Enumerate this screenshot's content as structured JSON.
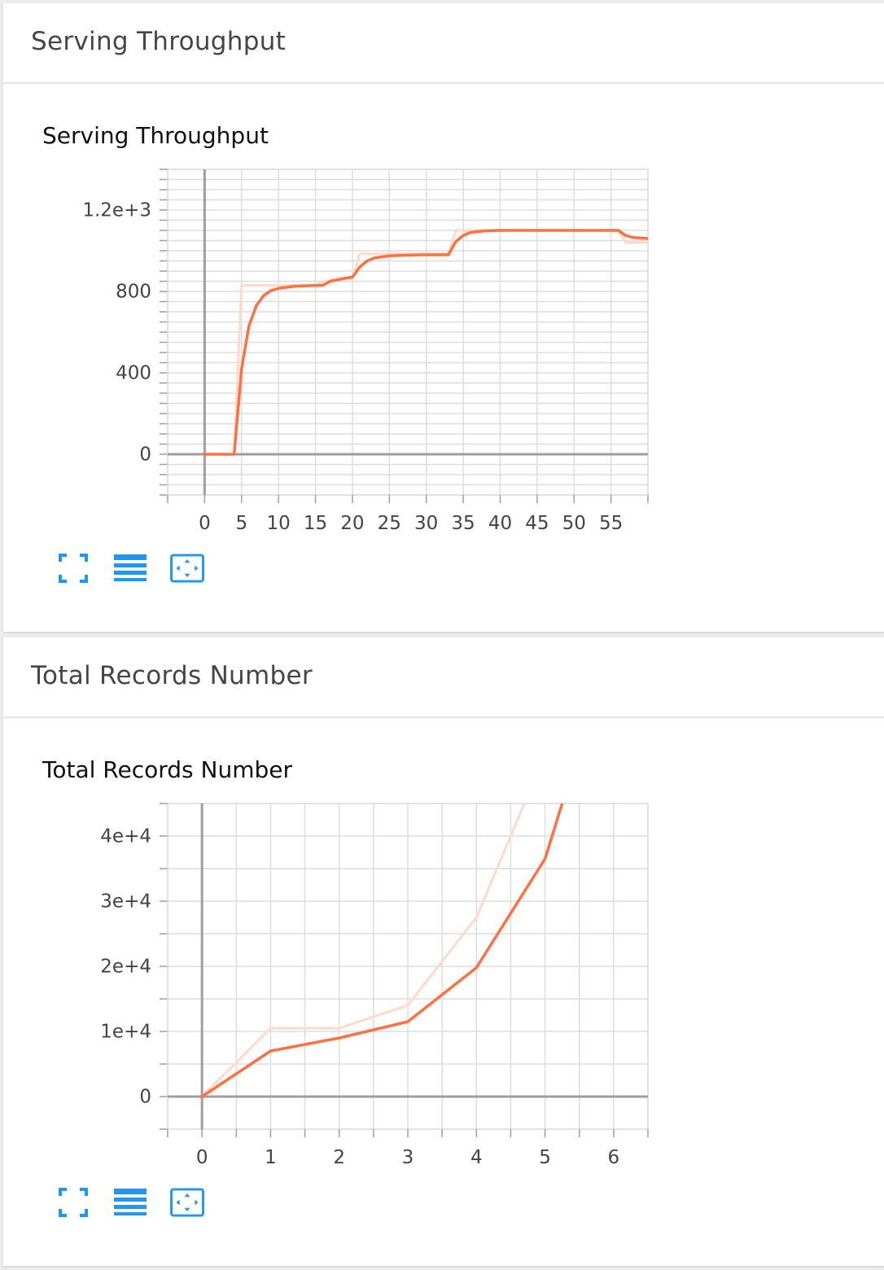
{
  "colors": {
    "smoothed": "#ff7043",
    "raw": "#ffd9cc",
    "grid": "#dddddd",
    "axis": "#9e9e9e",
    "tool": "#2196f3"
  },
  "toolbar": {
    "fit_icon": "fullscreen-icon",
    "log_icon": "lines-icon",
    "zoom_icon": "fit-domain-icon"
  },
  "cards": [
    {
      "header": "Serving Throughput",
      "chart_title": "Serving Throughput",
      "y_ticks": [
        "0",
        "400",
        "800",
        "1.2e+3"
      ],
      "x_ticks": [
        "0",
        "5",
        "10",
        "15",
        "20",
        "25",
        "30",
        "35",
        "40",
        "45",
        "50",
        "55"
      ]
    },
    {
      "header": "Total Records Number",
      "chart_title": "Total Records Number",
      "y_ticks": [
        "0",
        "1e+4",
        "2e+4",
        "3e+4",
        "4e+4"
      ],
      "x_ticks": [
        "0",
        "1",
        "2",
        "3",
        "4",
        "5",
        "6"
      ]
    }
  ],
  "chart_data": [
    {
      "type": "line",
      "title": "Serving Throughput",
      "xlabel": "",
      "ylabel": "",
      "xlim": [
        -5,
        60
      ],
      "ylim": [
        -200,
        1400
      ],
      "grid": true,
      "series": [
        {
          "role": "smoothed",
          "x": [
            0,
            4,
            5,
            6,
            7,
            8,
            9,
            10,
            12,
            14,
            16,
            17,
            19,
            20,
            21,
            22,
            23,
            25,
            27,
            30,
            33,
            34,
            35,
            36,
            38,
            40,
            45,
            50,
            56,
            57,
            58,
            60
          ],
          "y": [
            0,
            0,
            420,
            630,
            730,
            780,
            805,
            815,
            825,
            828,
            830,
            850,
            865,
            870,
            920,
            950,
            965,
            975,
            978,
            980,
            980,
            1045,
            1075,
            1090,
            1098,
            1100,
            1100,
            1100,
            1100,
            1075,
            1065,
            1060
          ]
        },
        {
          "role": "raw",
          "x": [
            0,
            4,
            5,
            10,
            15,
            16,
            20,
            21,
            33,
            34,
            56,
            57,
            60
          ],
          "y": [
            0,
            0,
            830,
            830,
            830,
            850,
            865,
            985,
            985,
            1100,
            1100,
            1040,
            1040
          ]
        }
      ]
    },
    {
      "type": "line",
      "title": "Total Records Number",
      "xlabel": "",
      "ylabel": "",
      "xlim": [
        -0.5,
        6.5
      ],
      "ylim": [
        -5000,
        45000
      ],
      "grid": true,
      "series": [
        {
          "role": "smoothed",
          "x": [
            0,
            1,
            2,
            3,
            4,
            5,
            5.25
          ],
          "y": [
            0,
            7000,
            9000,
            11500,
            19800,
            36500,
            45000
          ]
        },
        {
          "role": "raw",
          "x": [
            0,
            1,
            2,
            3,
            4,
            4.7
          ],
          "y": [
            0,
            10500,
            10500,
            14000,
            27500,
            45000
          ]
        }
      ]
    }
  ]
}
